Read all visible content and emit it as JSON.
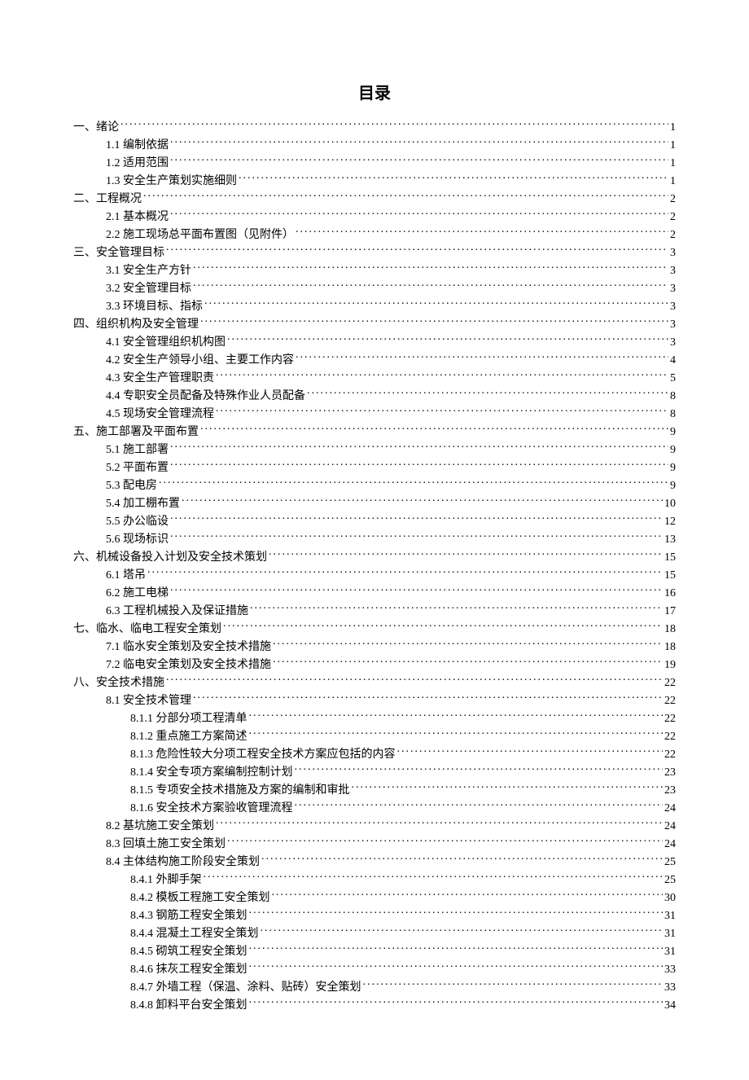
{
  "title": "目录",
  "toc": [
    {
      "level": 1,
      "label": "一、绪论",
      "page": "1"
    },
    {
      "level": 2,
      "label": "1.1 编制依据",
      "page": "1"
    },
    {
      "level": 2,
      "label": "1.2 适用范围",
      "page": "1"
    },
    {
      "level": 2,
      "label": "1.3 安全生产策划实施细则",
      "page": "1"
    },
    {
      "level": 1,
      "label": "二、工程概况",
      "page": "2"
    },
    {
      "level": 2,
      "label": "2.1 基本概况",
      "page": "2"
    },
    {
      "level": 2,
      "label": "2.2 施工现场总平面布置图（见附件）",
      "page": "2"
    },
    {
      "level": 1,
      "label": "三、安全管理目标",
      "page": "3"
    },
    {
      "level": 2,
      "label": "3.1 安全生产方针",
      "page": "3"
    },
    {
      "level": 2,
      "label": "3.2 安全管理目标",
      "page": "3"
    },
    {
      "level": 2,
      "label": "3.3 环境目标、指标",
      "page": "3"
    },
    {
      "level": 1,
      "label": "四、组织机构及安全管理",
      "page": "3"
    },
    {
      "level": 2,
      "label": "4.1 安全管理组织机构图",
      "page": "3"
    },
    {
      "level": 2,
      "label": "4.2 安全生产领导小组、主要工作内容",
      "page": "4"
    },
    {
      "level": 2,
      "label": "4.3 安全生产管理职责",
      "page": "5"
    },
    {
      "level": 2,
      "label": "4.4 专职安全员配备及特殊作业人员配备",
      "page": "8"
    },
    {
      "level": 2,
      "label": "4.5 现场安全管理流程",
      "page": "8"
    },
    {
      "level": 1,
      "label": "五、施工部署及平面布置",
      "page": "9"
    },
    {
      "level": 2,
      "label": "5.1 施工部署",
      "page": "9"
    },
    {
      "level": 2,
      "label": "5.2 平面布置",
      "page": "9"
    },
    {
      "level": 2,
      "label": "5.3  配电房",
      "page": "9"
    },
    {
      "level": 2,
      "label": "5.4  加工棚布置",
      "page": "10"
    },
    {
      "level": 2,
      "label": "5.5  办公临设",
      "page": "12"
    },
    {
      "level": 2,
      "label": "5.6  现场标识",
      "page": "13"
    },
    {
      "level": 1,
      "label": "六、机械设备投入计划及安全技术策划",
      "page": "15"
    },
    {
      "level": 2,
      "label": "6.1 塔吊",
      "page": "15"
    },
    {
      "level": 2,
      "label": "6.2 施工电梯",
      "page": "16"
    },
    {
      "level": 2,
      "label": "6.3 工程机械投入及保证措施",
      "page": "17"
    },
    {
      "level": 1,
      "label": "七、临水、临电工程安全策划",
      "page": "18"
    },
    {
      "level": 2,
      "label": "7.1 临水安全策划及安全技术措施",
      "page": "18"
    },
    {
      "level": 2,
      "label": "7.2 临电安全策划及安全技术措施",
      "page": "19"
    },
    {
      "level": 1,
      "label": "八、安全技术措施",
      "page": "22"
    },
    {
      "level": 2,
      "label": "8.1 安全技术管理",
      "page": "22"
    },
    {
      "level": 3,
      "label": "8.1.1 分部分项工程清单",
      "page": "22"
    },
    {
      "level": 3,
      "label": "8.1.2 重点施工方案简述",
      "page": "22"
    },
    {
      "level": 3,
      "label": "8.1.3 危险性较大分项工程安全技术方案应包括的内容",
      "page": "22"
    },
    {
      "level": 3,
      "label": "8.1.4 安全专项方案编制控制计划",
      "page": "23"
    },
    {
      "level": 3,
      "label": "8.1.5 专项安全技术措施及方案的编制和审批",
      "page": "23"
    },
    {
      "level": 3,
      "label": "8.1.6 安全技术方案验收管理流程",
      "page": "24"
    },
    {
      "level": 2,
      "label": "8.2 基坑施工安全策划",
      "page": "24"
    },
    {
      "level": 2,
      "label": "8.3 回填土施工安全策划",
      "page": "24"
    },
    {
      "level": 2,
      "label": "8.4 主体结构施工阶段安全策划",
      "page": "25"
    },
    {
      "level": 3,
      "label": "8.4.1 外脚手架",
      "page": "25"
    },
    {
      "level": 3,
      "label": "8.4.2 模板工程施工安全策划",
      "page": "30"
    },
    {
      "level": 3,
      "label": "8.4.3 钢筋工程安全策划",
      "page": "31"
    },
    {
      "level": 3,
      "label": "8.4.4 混凝土工程安全策划",
      "page": "31"
    },
    {
      "level": 3,
      "label": "8.4.5 砌筑工程安全策划",
      "page": "31"
    },
    {
      "level": 3,
      "label": "8.4.6 抹灰工程安全策划",
      "page": "33"
    },
    {
      "level": 3,
      "label": "8.4.7 外墙工程（保温、涂料、贴砖）安全策划",
      "page": "33"
    },
    {
      "level": 3,
      "label": "8.4.8 卸料平台安全策划",
      "page": "34"
    }
  ]
}
